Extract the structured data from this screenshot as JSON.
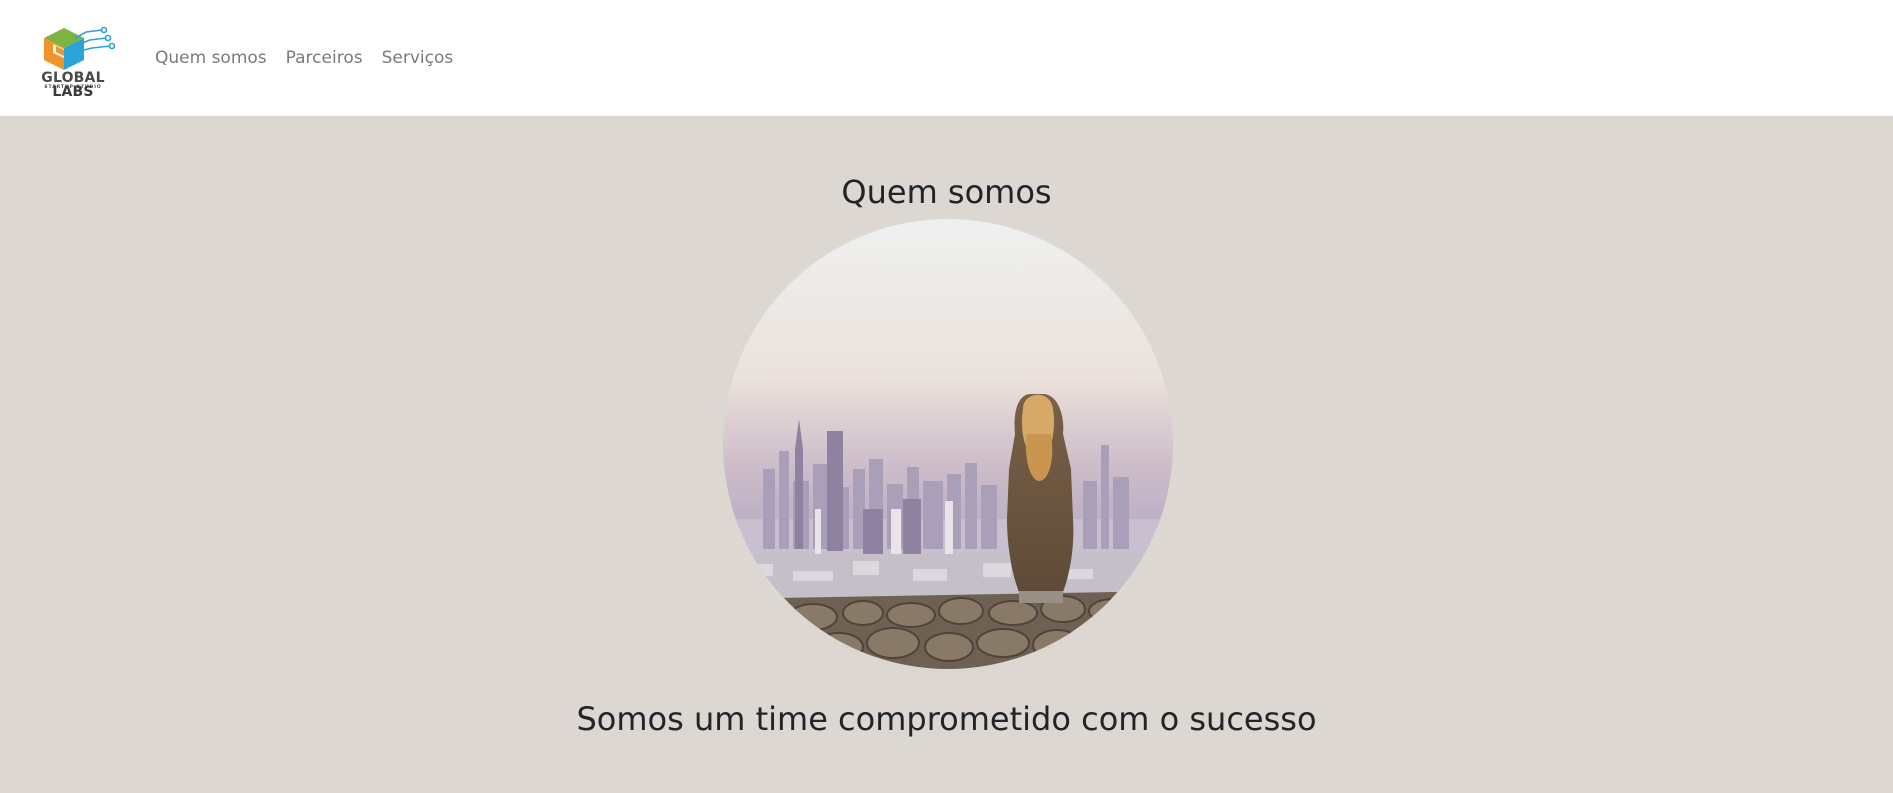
{
  "brand": {
    "name_part1": "GLOBAL ",
    "name_part2": "LABS",
    "tagline": "STARTUP STUDIO",
    "colors": {
      "green": "#7cb342",
      "orange": "#f0932b",
      "blue": "#29a3d8"
    }
  },
  "nav": {
    "items": [
      {
        "label": "Quem somos"
      },
      {
        "label": "Parceiros"
      },
      {
        "label": "Serviços"
      }
    ]
  },
  "hero": {
    "title": "Quem somos",
    "image_icon": "woman-overlooking-city-photo",
    "subtitle": "Somos um time comprometido com o sucesso",
    "background": "#dcd7d1"
  }
}
